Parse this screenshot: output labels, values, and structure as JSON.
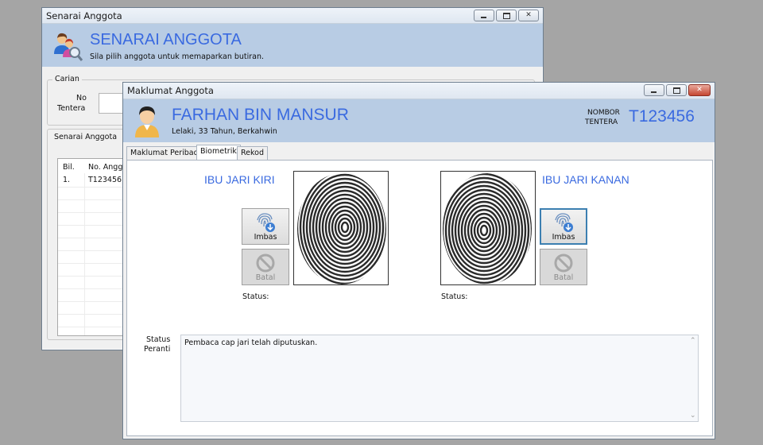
{
  "back_window": {
    "title": "Senarai Anggota",
    "heading": "SENARAI ANGGOTA",
    "subtitle": "Sila pilih anggota untuk memaparkan butiran.",
    "search_group": "Carian",
    "search_label_1": "No",
    "search_label_2": "Tentera",
    "list_group": "Senarai Anggota",
    "columns": [
      "Bil.",
      "No. Anggo"
    ],
    "rows": [
      [
        "1.",
        "T123456"
      ]
    ]
  },
  "front_window": {
    "title": "Maklumat Anggota",
    "name": "FARHAN BIN MANSUR",
    "details": "Lelaki, 33 Tahun, Berkahwin",
    "nombor_label_1": "NOMBOR",
    "nombor_label_2": "TENTERA",
    "nombor_value": "T123456",
    "tabs": [
      "Maklumat Peribadi",
      "Biometrik",
      "Rekod"
    ],
    "active_tab": "Biometrik",
    "left": {
      "label": "IBU JARI KIRI",
      "scan_label": "Imbas",
      "cancel_label": "Batal",
      "status_label": "Status:"
    },
    "right": {
      "label": "IBU JARI KANAN",
      "scan_label": "Imbas",
      "cancel_label": "Batal",
      "status_label": "Status:"
    },
    "device_status_label_1": "Status",
    "device_status_label_2": "Peranti",
    "device_status_text": "Pembaca cap jari telah diputuskan."
  },
  "colors": {
    "accent": "#3a6ae0",
    "banner": "#b8cce4",
    "focus": "#3c7fb1"
  }
}
